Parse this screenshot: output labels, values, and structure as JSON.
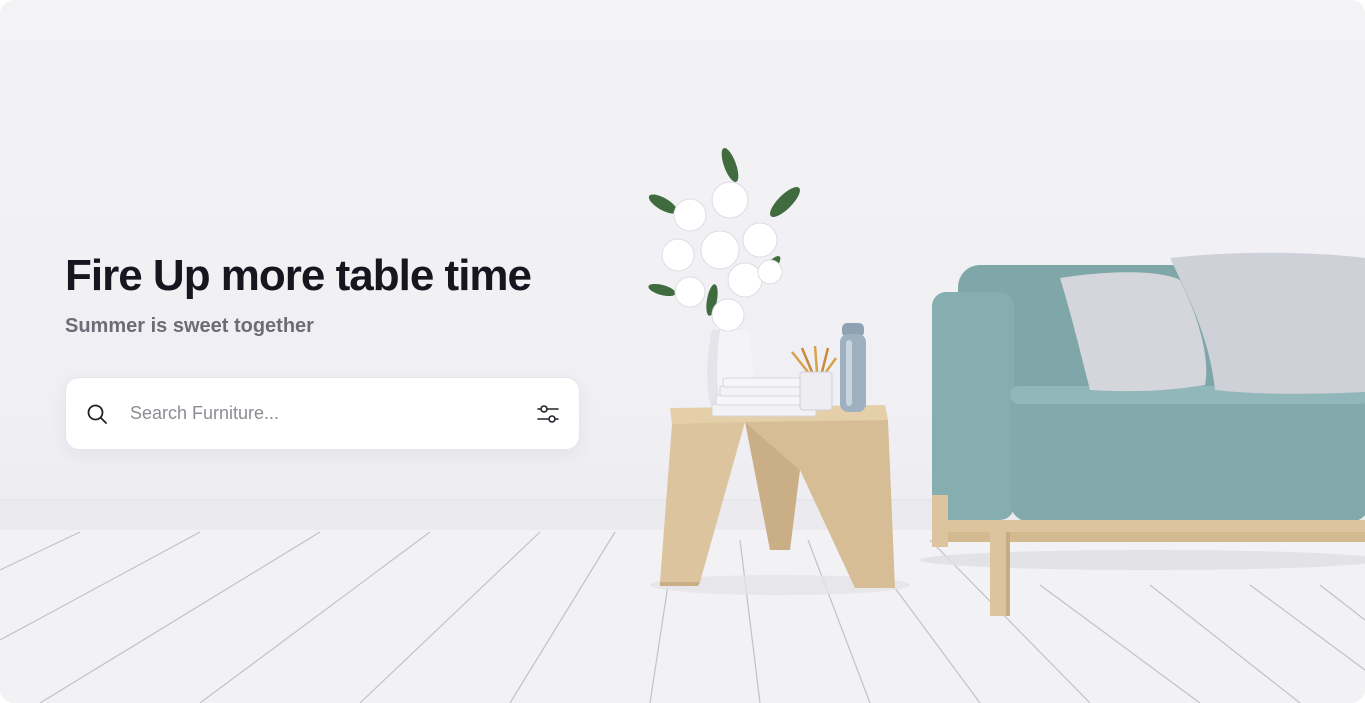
{
  "hero": {
    "headline": "Fire Up more table time",
    "subheadline": "Summer is sweet together"
  },
  "search": {
    "placeholder": "Search Furniture...",
    "value": "",
    "icon": "search-icon",
    "filter_icon": "sliders-icon"
  },
  "colors": {
    "headline": "#16161f",
    "subheadline": "#6c6c76",
    "sofa": "#7ea8ab",
    "wood": "#dcc49e",
    "background": "#f1f1f5"
  }
}
